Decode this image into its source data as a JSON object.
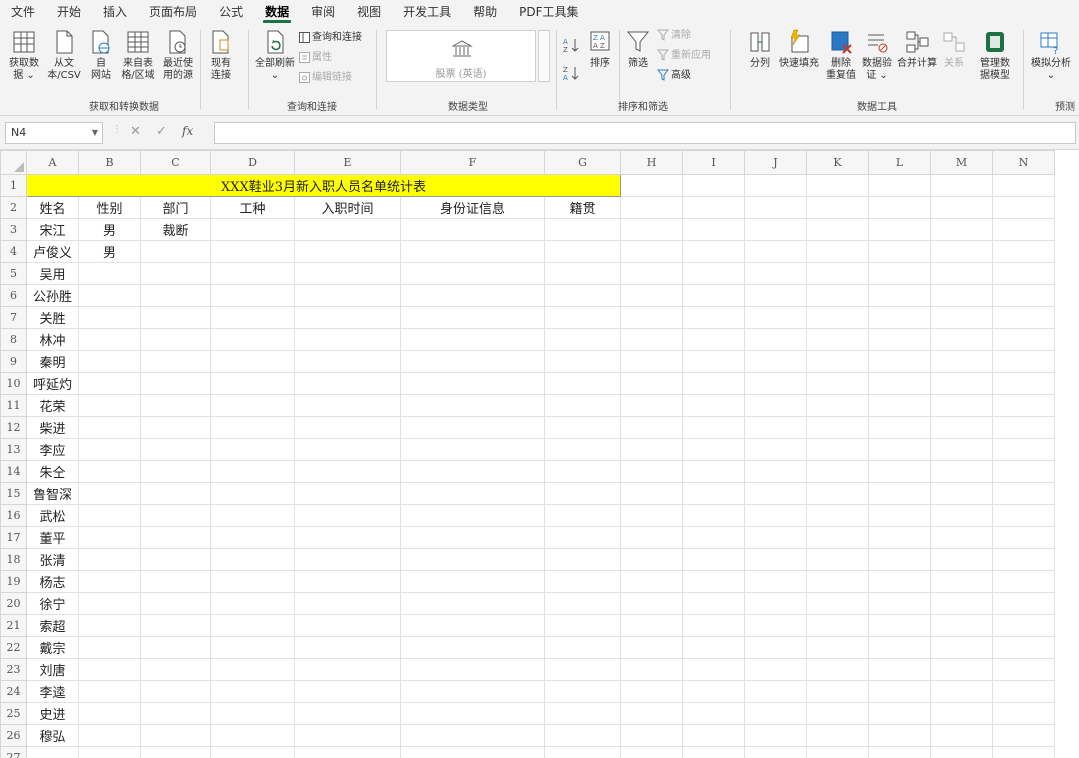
{
  "menu": [
    "文件",
    "开始",
    "插入",
    "页面布局",
    "公式",
    "数据",
    "审阅",
    "视图",
    "开发工具",
    "帮助",
    "PDF工具集"
  ],
  "menu_active_index": 5,
  "ribbon": {
    "get_data": {
      "label": "获取和转换数据",
      "buttons": [
        "获取数\n据 ⌄",
        "从文\n本/CSV",
        "自\n网站",
        "来自表\n格/区域",
        "最近使\n用的源",
        "现有\n连接"
      ]
    },
    "queries": {
      "label": "查询和连接",
      "refresh": "全部刷新\n⌄",
      "queries_connections": "查询和连接",
      "properties": "属性",
      "edit_links": "编辑链接"
    },
    "data_types": {
      "label": "数据类型",
      "stocks": "股票 (英语)"
    },
    "sort_filter": {
      "label": "排序和筛选",
      "sort": "排序",
      "filter": "筛选",
      "clear": "清除",
      "reapply": "重新应用",
      "advanced": "高级"
    },
    "data_tools": {
      "label": "数据工具",
      "buttons": [
        "分列",
        "快速填充",
        "删除\n重复值",
        "数据验\n证 ⌄",
        "合并计算",
        "关系",
        "管理数\n据模型"
      ]
    },
    "forecast": {
      "label": "预测",
      "what_if": "模拟分析\n⌄"
    }
  },
  "formula_bar": {
    "name_box": "N4",
    "fx": "fx",
    "content": ""
  },
  "sheet": {
    "columns": [
      "A",
      "B",
      "C",
      "D",
      "E",
      "F",
      "G",
      "H",
      "I",
      "J",
      "K",
      "L",
      "M",
      "N"
    ],
    "title": "XXX鞋业3月新入职人员名单统计表",
    "headers": [
      "姓名",
      "性别",
      "部门",
      "工种",
      "入职时间",
      "身份证信息",
      "籍贯"
    ],
    "rows": [
      [
        "宋江",
        "男",
        "裁断"
      ],
      [
        "卢俊义",
        "男",
        ""
      ],
      [
        "吴用",
        "",
        ""
      ],
      [
        "公孙胜",
        "",
        ""
      ],
      [
        "关胜",
        "",
        ""
      ],
      [
        "林冲",
        "",
        ""
      ],
      [
        "秦明",
        "",
        ""
      ],
      [
        "呼延灼",
        "",
        ""
      ],
      [
        "花荣",
        "",
        ""
      ],
      [
        "柴进",
        "",
        ""
      ],
      [
        "李应",
        "",
        ""
      ],
      [
        "朱仝",
        "",
        ""
      ],
      [
        "鲁智深",
        "",
        ""
      ],
      [
        "武松",
        "",
        ""
      ],
      [
        "董平",
        "",
        ""
      ],
      [
        "张清",
        "",
        ""
      ],
      [
        "杨志",
        "",
        ""
      ],
      [
        "徐宁",
        "",
        ""
      ],
      [
        "索超",
        "",
        ""
      ],
      [
        "戴宗",
        "",
        ""
      ],
      [
        "刘唐",
        "",
        ""
      ],
      [
        "李逵",
        "",
        ""
      ],
      [
        "史进",
        "",
        ""
      ],
      [
        "穆弘",
        "",
        ""
      ]
    ],
    "row_numbers": [
      "1",
      "2",
      "3",
      "4",
      "5",
      "6",
      "7",
      "8",
      "9",
      "10",
      "11",
      "12",
      "13",
      "14",
      "15",
      "16",
      "17",
      "18",
      "19",
      "20",
      "21",
      "22",
      "23",
      "24",
      "25",
      "26",
      "27"
    ]
  },
  "colors": {
    "accent": "#1e7145",
    "title_fill": "#ffff00"
  }
}
